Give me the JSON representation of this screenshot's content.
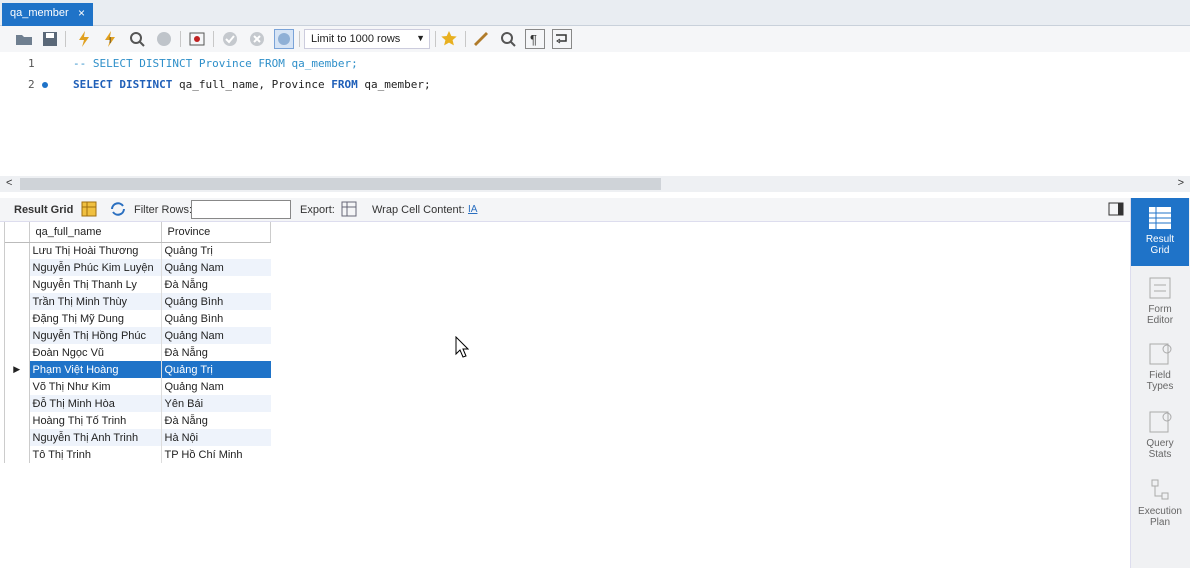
{
  "tab": {
    "title": "qa_member",
    "close": "×"
  },
  "toolbar": {
    "icons": [
      "open-folder-icon",
      "save-icon",
      "execute-icon",
      "execute-current-icon",
      "explain-icon",
      "stop-icon",
      "toggle-results-icon",
      "commit-icon",
      "rollback-icon",
      "autocommit-icon",
      "bookmark-star-icon",
      "beautify-icon",
      "find-icon",
      "invisible-chars-icon",
      "wrap-icon"
    ],
    "limit": "Limit to 1000 rows"
  },
  "editor": {
    "lines": [
      {
        "num": "1",
        "text": "-- SELECT DISTINCT Province FROM qa_member;"
      },
      {
        "num": "2",
        "text": "SELECT DISTINCT qa_full_name, Province FROM qa_member;"
      }
    ]
  },
  "result_toolbar": {
    "result_grid": "Result Grid",
    "filter_rows": "Filter Rows:",
    "filter_value": "",
    "export": "Export:",
    "wrap": "Wrap Cell Content:"
  },
  "grid": {
    "columns": [
      "qa_full_name",
      "Province"
    ],
    "rows": [
      [
        "Lưu Thị Hoài Thương",
        "Quảng Trị"
      ],
      [
        "Nguyễn Phúc Kim Luyện",
        "Quảng Nam"
      ],
      [
        "Nguyễn Thị Thanh Ly",
        "Đà Nẵng"
      ],
      [
        "Trần Thị Minh Thùy",
        "Quảng Bình"
      ],
      [
        "Đặng Thị Mỹ Dung",
        "Quảng Bình"
      ],
      [
        "Nguyễn Thị Hồng Phúc",
        "Quảng Nam"
      ],
      [
        "Đoàn Ngọc Vũ",
        "Đà Nẵng"
      ],
      [
        "Phạm Việt Hoàng",
        "Quảng Trị"
      ],
      [
        "Võ Thị Như Kim",
        "Quảng Nam"
      ],
      [
        "Đỗ Thị Minh Hòa",
        "Yên Bái"
      ],
      [
        "Hoàng Thị Tố Trinh",
        "Đà Nẵng"
      ],
      [
        "Nguyễn Thị Anh Trinh",
        "Hà Nội"
      ],
      [
        "Tô Thị Trinh",
        "TP Hồ Chí Minh"
      ]
    ],
    "selected_index": 7
  },
  "side_panel": [
    {
      "line1": "Result",
      "line2": "Grid",
      "active": true
    },
    {
      "line1": "Form",
      "line2": "Editor",
      "active": false
    },
    {
      "line1": "Field",
      "line2": "Types",
      "active": false
    },
    {
      "line1": "Query",
      "line2": "Stats",
      "active": false
    },
    {
      "line1": "Execution",
      "line2": "Plan",
      "active": false
    }
  ]
}
